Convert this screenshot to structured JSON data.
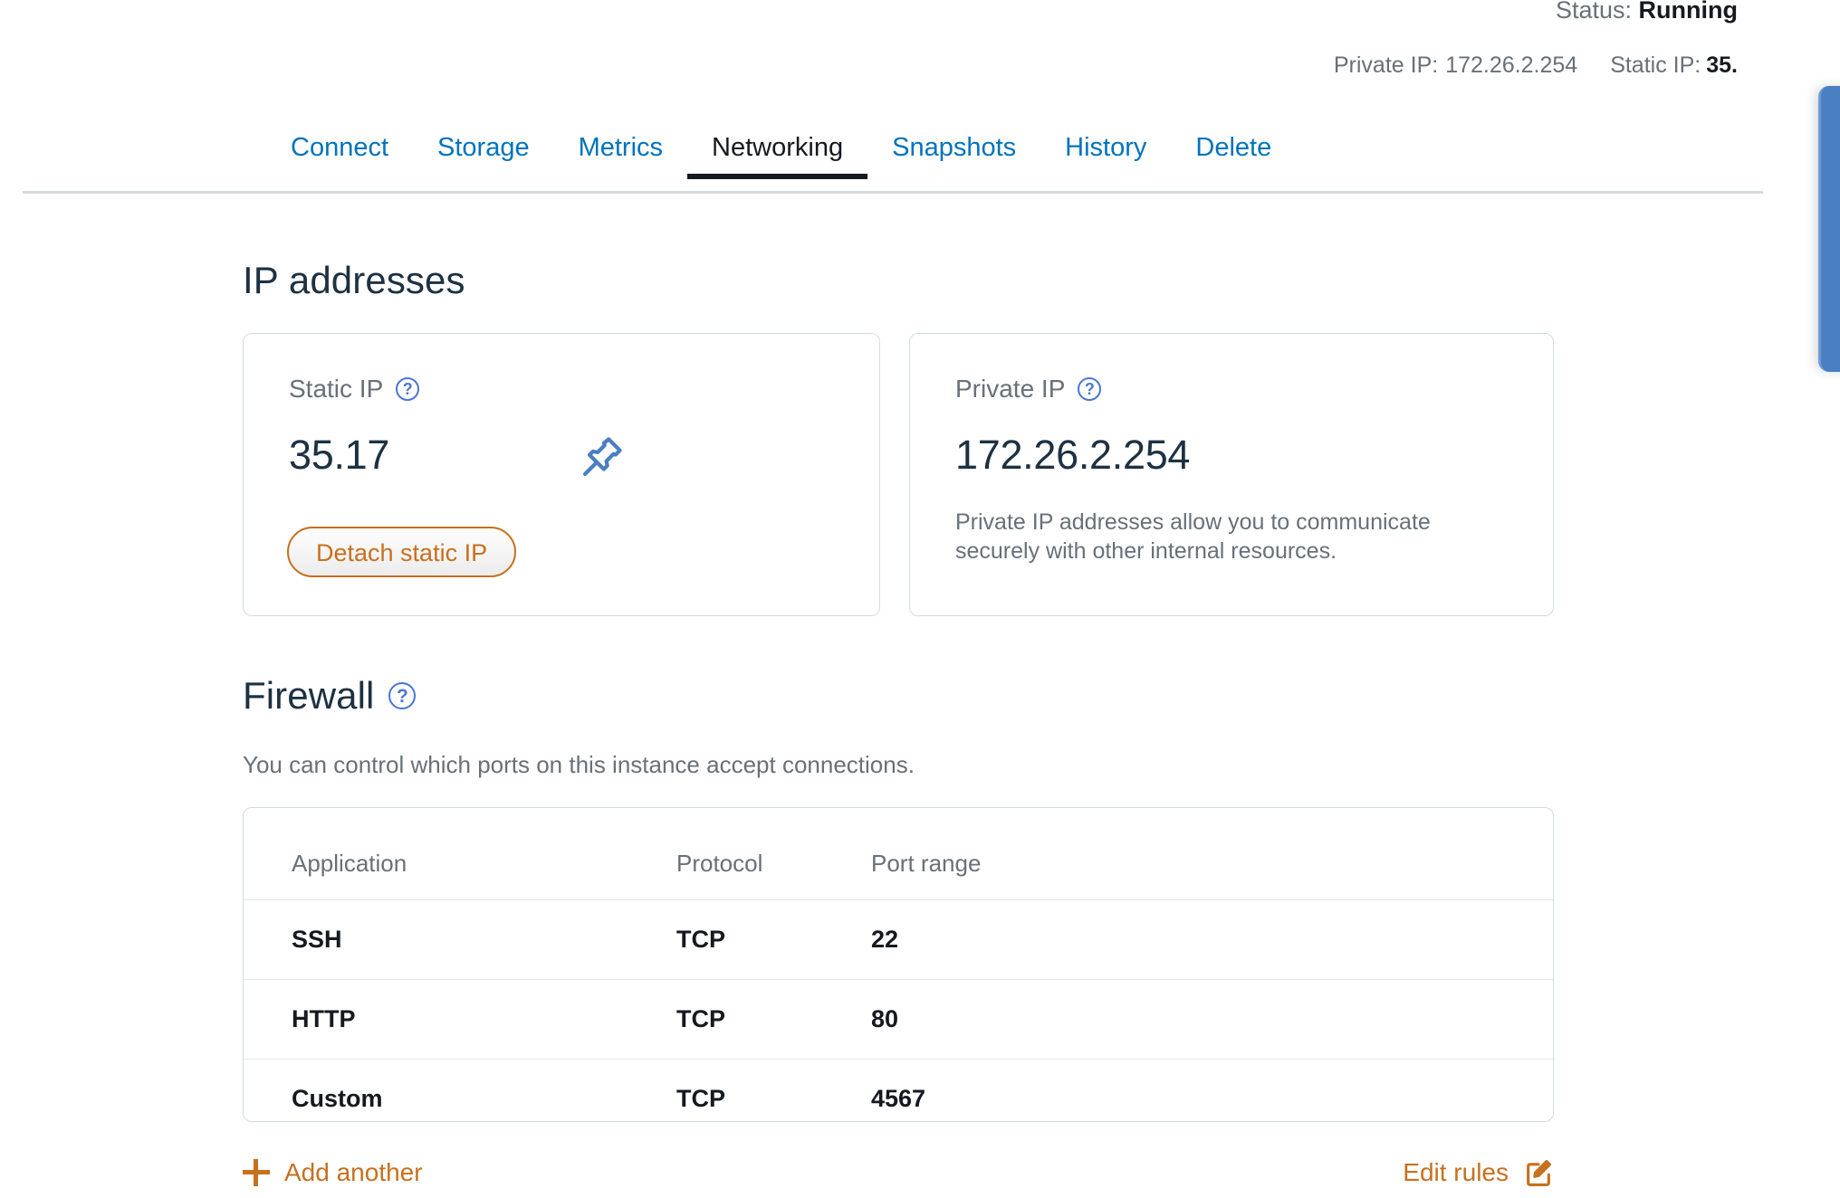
{
  "header": {
    "status_label": "Status:",
    "status_value": "Running",
    "private_ip_label": "Private IP:",
    "private_ip_value": "172.26.2.254",
    "static_ip_label": "Static IP:",
    "static_ip_value": "35."
  },
  "tabs": [
    {
      "label": "Connect",
      "active": false
    },
    {
      "label": "Storage",
      "active": false
    },
    {
      "label": "Metrics",
      "active": false
    },
    {
      "label": "Networking",
      "active": true
    },
    {
      "label": "Snapshots",
      "active": false
    },
    {
      "label": "History",
      "active": false
    },
    {
      "label": "Delete",
      "active": false
    }
  ],
  "ip_section": {
    "heading": "IP addresses",
    "help_glyph": "?",
    "static_card": {
      "label": "Static IP",
      "value": "35.17",
      "button_label": "Detach static IP",
      "pin_icon": "pin-icon"
    },
    "private_card": {
      "label": "Private IP",
      "value": "172.26.2.254",
      "description": "Private IP addresses allow you to communicate securely with other internal resources."
    }
  },
  "firewall_section": {
    "heading": "Firewall",
    "help_glyph": "?",
    "description": "You can control which ports on this instance accept connections.",
    "columns": [
      "Application",
      "Protocol",
      "Port range"
    ],
    "rows": [
      {
        "application": "SSH",
        "protocol": "TCP",
        "port_range": "22"
      },
      {
        "application": "HTTP",
        "protocol": "TCP",
        "port_range": "80"
      },
      {
        "application": "Custom",
        "protocol": "TCP",
        "port_range": "4567"
      }
    ],
    "add_another_label": "Add another",
    "edit_rules_label": "Edit rules"
  },
  "colors": {
    "link_blue": "#0073bb",
    "accent_orange": "#c7701e",
    "text_dark": "#16191f",
    "text_muted": "#687078",
    "heading_navy": "#1d3142",
    "border_gray": "#d5dbdb",
    "feedback_blue": "#4a7fc1",
    "help_blue": "#4a76d4"
  }
}
